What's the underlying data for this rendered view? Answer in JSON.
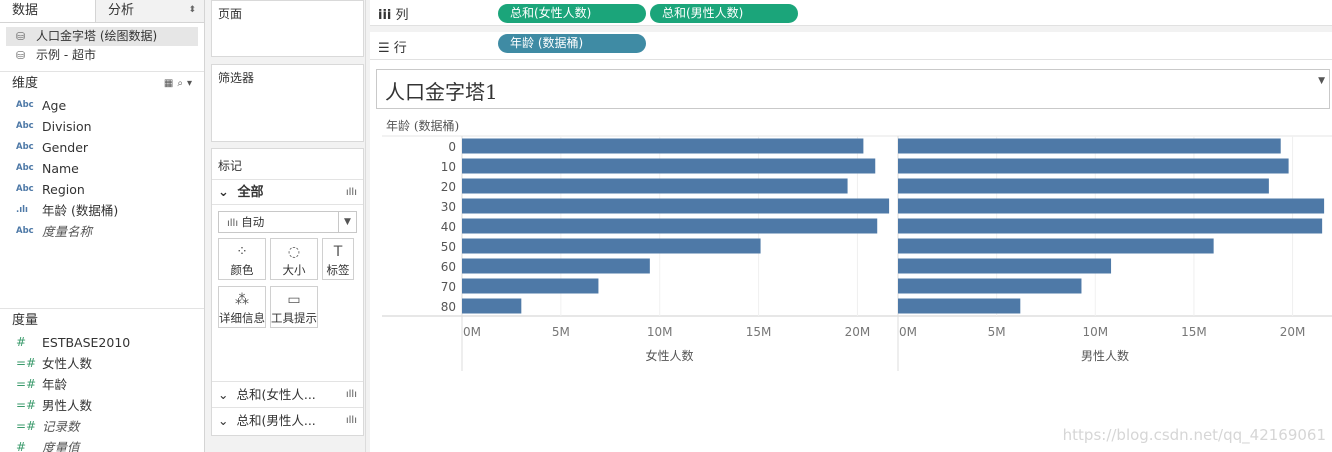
{
  "tabs": {
    "data": "数据",
    "analysis": "分析"
  },
  "datasources": [
    {
      "label": "人口金字塔 (绘图数据)",
      "selected": true
    },
    {
      "label": "示例 - 超市",
      "selected": false
    }
  ],
  "dimensions": {
    "heading": "维度",
    "fields": [
      {
        "icon": "Abc",
        "label": "Age"
      },
      {
        "icon": "Abc",
        "label": "Division"
      },
      {
        "icon": "Abc",
        "label": "Gender"
      },
      {
        "icon": "Abc",
        "label": "Name"
      },
      {
        "icon": "Abc",
        "label": "Region"
      },
      {
        "icon": ".ılı",
        "label": "年龄 (数据桶)"
      },
      {
        "icon": "Abc",
        "label": "度量名称"
      }
    ]
  },
  "measures": {
    "heading": "度量",
    "fields": [
      {
        "icon": "#",
        "label": "ESTBASE2010"
      },
      {
        "icon": "=#",
        "label": "女性人数"
      },
      {
        "icon": "=#",
        "label": "年龄"
      },
      {
        "icon": "=#",
        "label": "男性人数"
      },
      {
        "icon": "=#",
        "label": "记录数"
      },
      {
        "icon": "#",
        "label": "度量值"
      }
    ]
  },
  "cards": {
    "pages": "页面",
    "filters": "筛选器",
    "marks": "标记",
    "marks_all": "全部",
    "mark_type": "自动",
    "buttons": [
      {
        "icon": "color-icon",
        "glyph": "⁘",
        "label": "颜色"
      },
      {
        "icon": "size-icon",
        "glyph": "◌",
        "label": "大小"
      },
      {
        "icon": "label-icon",
        "glyph": "T",
        "label": "标签"
      },
      {
        "icon": "detail-icon",
        "glyph": "⁂",
        "label": "详细信息"
      },
      {
        "icon": "tooltip-icon",
        "glyph": "▭",
        "label": "工具提示"
      }
    ],
    "mark_rows": [
      "总和(女性人...",
      "总和(男性人..."
    ]
  },
  "shelves": {
    "columns_label": "列",
    "rows_label": "行",
    "column_pills": [
      "总和(女性人数)",
      "总和(男性人数)"
    ],
    "row_pills": [
      "年龄 (数据桶)"
    ]
  },
  "sheet": {
    "title": "人口金字塔1"
  },
  "watermark": "https://blog.csdn.net/qq_42169061",
  "colors": {
    "bar": "#4e79a7",
    "green_pill": "#1ba57a",
    "blue_pill": "#3f8ba4"
  },
  "chart_data": {
    "type": "bar",
    "orientation": "horizontal",
    "row_header": "年龄 (数据桶)",
    "categories": [
      "0",
      "10",
      "20",
      "30",
      "40",
      "50",
      "60",
      "70",
      "80"
    ],
    "panels": [
      {
        "xlabel": "女性人数",
        "values": [
          20.3,
          20.9,
          19.5,
          21.6,
          21.0,
          15.1,
          9.5,
          6.9,
          3.0
        ]
      },
      {
        "xlabel": "男性人数",
        "values": [
          19.4,
          19.8,
          18.8,
          21.6,
          21.5,
          16.0,
          10.8,
          9.3,
          6.2
        ]
      }
    ],
    "x_ticks": [
      "0M",
      "5M",
      "10M",
      "15M",
      "20M"
    ],
    "x_unit": "M",
    "xlim": [
      0,
      22
    ]
  }
}
